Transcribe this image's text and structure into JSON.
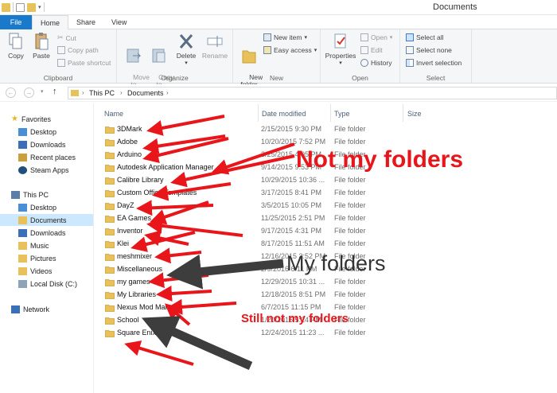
{
  "window": {
    "title": "Documents"
  },
  "tabs": [
    {
      "label": "File"
    },
    {
      "label": "Home"
    },
    {
      "label": "Share"
    },
    {
      "label": "View"
    }
  ],
  "ribbon": {
    "clipboard": {
      "label": "Clipboard",
      "copy": "Copy",
      "paste": "Paste",
      "cut": "Cut",
      "copy_path": "Copy path",
      "paste_shortcut": "Paste shortcut"
    },
    "organize": {
      "label": "Organize",
      "move_to": "Move\nto",
      "copy_to": "Copy\nto",
      "delete": "Delete",
      "rename": "Rename"
    },
    "new": {
      "label": "New",
      "new_folder": "New\nfolder",
      "new_item": "New item",
      "easy_access": "Easy access"
    },
    "open": {
      "label": "Open",
      "properties": "Properties",
      "open": "Open",
      "edit": "Edit",
      "history": "History"
    },
    "select": {
      "label": "Select",
      "select_all": "Select all",
      "select_none": "Select none",
      "invert_selection": "Invert selection"
    }
  },
  "address": {
    "crumbs": [
      "This PC",
      "Documents"
    ]
  },
  "nav": {
    "favorites": "Favorites",
    "favorites_items": [
      "Desktop",
      "Downloads",
      "Recent places",
      "Steam Apps"
    ],
    "this_pc": "This PC",
    "pc_items": [
      "Desktop",
      "Documents",
      "Downloads",
      "Music",
      "Pictures",
      "Videos",
      "Local Disk (C:)"
    ],
    "network": "Network"
  },
  "columns": {
    "name": "Name",
    "date": "Date modified",
    "type": "Type",
    "size": "Size"
  },
  "files": [
    {
      "name": "3DMark",
      "date": "2/15/2015 9:30 PM",
      "type": "File folder"
    },
    {
      "name": "Adobe",
      "date": "10/20/2015 7:52 PM",
      "type": "File folder"
    },
    {
      "name": "Arduino",
      "date": "3/25/2015 4:05 PM",
      "type": "File folder"
    },
    {
      "name": "Autodesk Application Manager",
      "date": "9/14/2015 9:53 PM",
      "type": "File folder"
    },
    {
      "name": "Calibre Library",
      "date": "10/29/2015 10:36 ...",
      "type": "File folder"
    },
    {
      "name": "Custom Office Templates",
      "date": "3/17/2015 8:41 PM",
      "type": "File folder"
    },
    {
      "name": "DayZ",
      "date": "3/5/2015 10:05 PM",
      "type": "File folder"
    },
    {
      "name": "EA Games",
      "date": "11/25/2015 2:51 PM",
      "type": "File folder"
    },
    {
      "name": "Inventor",
      "date": "9/17/2015 4:31 PM",
      "type": "File folder"
    },
    {
      "name": "Klei",
      "date": "8/17/2015 11:51 AM",
      "type": "File folder"
    },
    {
      "name": "meshmixer",
      "date": "12/16/2015 3:52 PM",
      "type": "File folder"
    },
    {
      "name": "Miscellaneous",
      "date": "2/9/2016 6:11 PM",
      "type": "File folder"
    },
    {
      "name": "my games",
      "date": "12/29/2015 10:31 ...",
      "type": "File folder"
    },
    {
      "name": "My Libraries",
      "date": "12/18/2015 8:51 PM",
      "type": "File folder"
    },
    {
      "name": "Nexus Mod Manager",
      "date": "6/7/2015 11:15 PM",
      "type": "File folder"
    },
    {
      "name": "School",
      "date": "1/20/2016 5:24 PM",
      "type": "File folder"
    },
    {
      "name": "Square Enix",
      "date": "12/24/2015 11:23 ...",
      "type": "File folder"
    }
  ],
  "annotations": {
    "not_mine": "Not my folders",
    "mine": "My folders",
    "still_not": "Still not my folders"
  },
  "colors": {
    "accent": "#1979ca",
    "annotation_red": "#e8161b",
    "annotation_dark": "#3d3d3d",
    "folder": "#e8c15b",
    "selected": "#cce8ff"
  }
}
